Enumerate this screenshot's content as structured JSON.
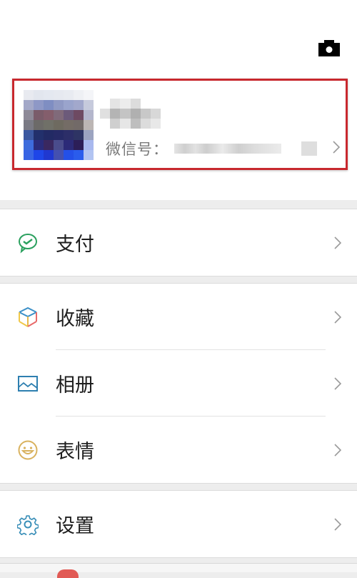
{
  "header": {
    "camera_icon": "camera-icon"
  },
  "profile": {
    "avatar_icon": "avatar-blurred",
    "nickname": "",
    "wechat_id_label": "微信号：",
    "wechat_id_value": "",
    "highlight_color": "#c8282e"
  },
  "menu": {
    "groups": [
      {
        "items": [
          {
            "label": "支付",
            "icon": "wechat-pay-icon",
            "color": "#1aad19"
          }
        ]
      },
      {
        "items": [
          {
            "label": "收藏",
            "icon": "favorites-cube-icon"
          },
          {
            "label": "相册",
            "icon": "album-image-icon"
          },
          {
            "label": "表情",
            "icon": "sticker-smile-icon"
          }
        ]
      },
      {
        "items": [
          {
            "label": "设置",
            "icon": "settings-gear-icon"
          }
        ]
      }
    ]
  }
}
